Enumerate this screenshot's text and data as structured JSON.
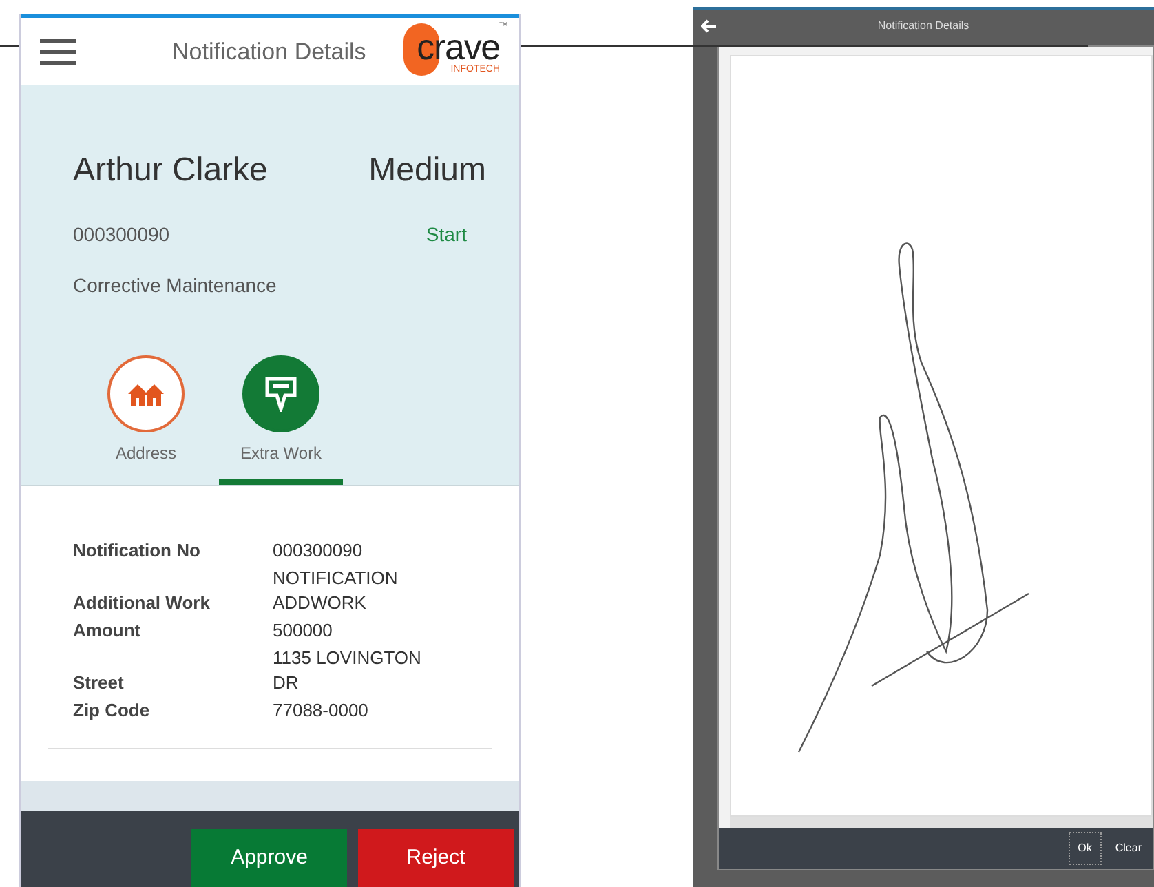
{
  "phone": {
    "header": {
      "title": "Notification Details",
      "logo": {
        "word": "crave",
        "sub": "INFOTECH",
        "mark": "™"
      }
    },
    "summary": {
      "name": "Arthur Clarke",
      "priority": "Medium",
      "number": "000300090",
      "status": "Start",
      "type": "Corrective Maintenance"
    },
    "tabs": [
      {
        "label": "Address",
        "kind": "address",
        "selected": false
      },
      {
        "label": "Extra Work",
        "kind": "extra",
        "selected": true
      }
    ],
    "details": [
      {
        "label": "Notification No",
        "value": "000300090"
      },
      {
        "label": "Additional Work",
        "value": "NOTIFICATION ADDWORK"
      },
      {
        "label": "Amount",
        "value": "500000"
      },
      {
        "label": "Street",
        "value": "1135 LOVINGTON DR"
      },
      {
        "label": "Zip Code",
        "value": "77088-0000"
      }
    ],
    "buttons": [
      {
        "label": "Approve",
        "kind": "approve"
      },
      {
        "label": "Reject",
        "kind": "reject"
      }
    ]
  },
  "signature_screen": {
    "title": "Notification Details",
    "buttons": [
      "Ok",
      "Clear"
    ]
  }
}
